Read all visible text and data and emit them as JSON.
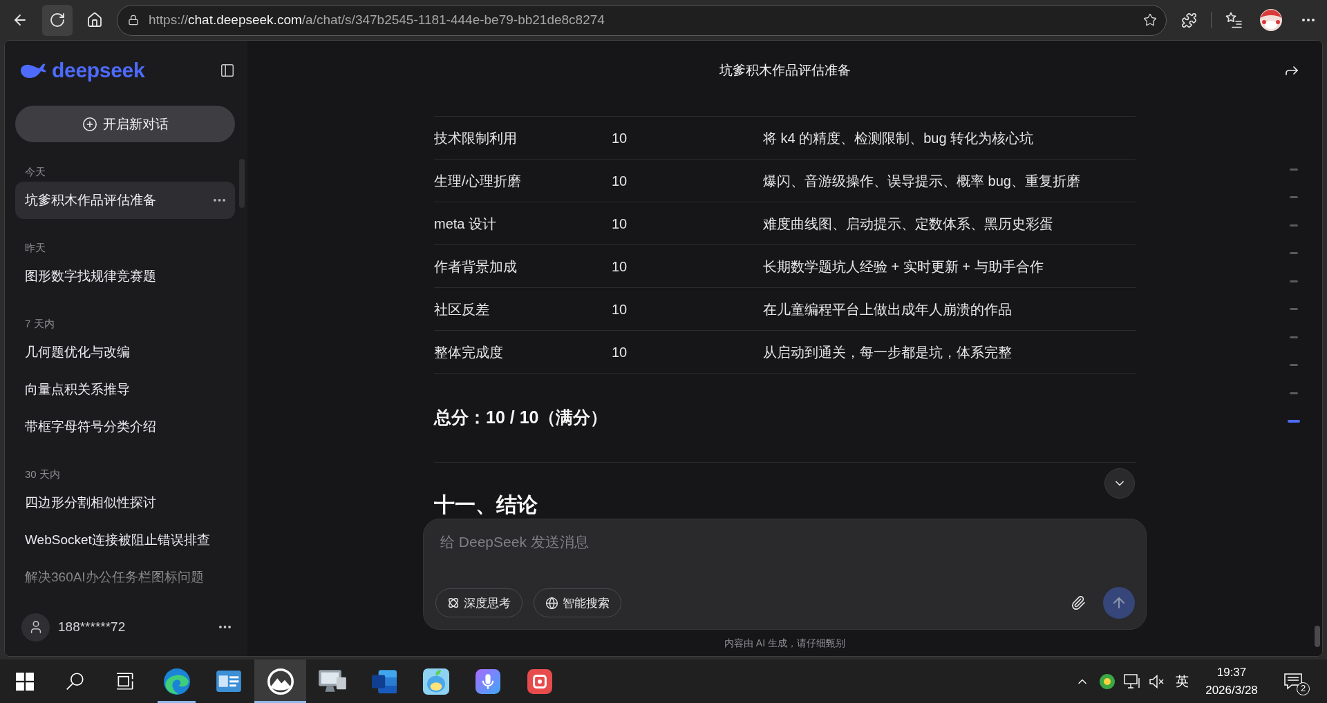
{
  "browser": {
    "nav_buttons": [
      {
        "kind": "back",
        "highlighted": false
      },
      {
        "kind": "refresh",
        "highlighted": true
      },
      {
        "kind": "home",
        "highlighted": false
      }
    ],
    "address": {
      "scheme": "https://",
      "host": "chat.deepseek.com",
      "path": "/a/chat/s/347b2545-1181-444e-be79-bb21de8c8274"
    },
    "toolbar": [
      {
        "kind": "extensions"
      },
      {
        "kind": "favorites"
      },
      {
        "kind": "profile"
      },
      {
        "kind": "more"
      }
    ]
  },
  "sidebar": {
    "logo": "deepseek",
    "new_chat": "开启新对话",
    "groups": [
      {
        "label": "今天",
        "items": [
          {
            "title": "坑爹积木作品评估准备",
            "selected": true
          }
        ]
      },
      {
        "label": "昨天",
        "items": [
          {
            "title": "图形数字找规律竞赛题",
            "selected": false
          }
        ]
      },
      {
        "label": "7 天内",
        "items": [
          {
            "title": "几何题优化与改编",
            "selected": false
          },
          {
            "title": "向量点积关系推导",
            "selected": false
          },
          {
            "title": "带框字母符号分类介绍",
            "selected": false
          }
        ]
      },
      {
        "label": "30 天内",
        "items": [
          {
            "title": "四边形分割相似性探讨",
            "selected": false
          },
          {
            "title": "WebSocket连接被阻止错误排查",
            "selected": false
          },
          {
            "title": "解决360AI办公任务栏图标问题",
            "selected": false
          }
        ]
      }
    ],
    "user": "188******72"
  },
  "chat": {
    "title": "坑爹积木作品评估准备",
    "table": {
      "rows": [
        [
          "技术限制利用",
          "10",
          "将 k4 的精度、检测限制、bug 转化为核心坑"
        ],
        [
          "生理/心理折磨",
          "10",
          "爆闪、音游级操作、误导提示、概率 bug、重复折磨"
        ],
        [
          "meta 设计",
          "10",
          "难度曲线图、启动提示、定数体系、黑历史彩蛋"
        ],
        [
          "作者背景加成",
          "10",
          "长期数学题坑人经验 + 实时更新 + 与助手合作"
        ],
        [
          "社区反差",
          "10",
          "在儿童编程平台上做出成年人崩溃的作品"
        ],
        [
          "整体完成度",
          "10",
          "从启动到通关，每一步都是坑，体系完整"
        ]
      ]
    },
    "summary": "总分：10 / 10（满分）",
    "section_heading": "十一、结论"
  },
  "message_markers": [
    {
      "selected": false
    },
    {
      "selected": false
    },
    {
      "selected": false
    },
    {
      "selected": false
    },
    {
      "selected": false
    },
    {
      "selected": false
    },
    {
      "selected": false
    },
    {
      "selected": false
    },
    {
      "selected": false
    },
    {
      "selected": true
    }
  ],
  "composer": {
    "placeholder": "给 DeepSeek 发送消息",
    "toggles": [
      {
        "kind": "deep_think",
        "label": "深度思考",
        "on": false
      },
      {
        "kind": "web_search",
        "label": "智能搜索",
        "on": false
      }
    ],
    "send_button": {
      "disabled": true
    },
    "disclaimer": "内容由 AI 生成，请仔细甄别"
  },
  "taskbar": {
    "buttons": [
      {
        "kind": "start"
      },
      {
        "kind": "search"
      },
      {
        "kind": "task_view"
      }
    ],
    "apps": [
      {
        "kind": "edge",
        "running": true,
        "selected": false
      },
      {
        "kind": "card",
        "running": false,
        "selected": false
      },
      {
        "kind": "mountain",
        "running": true,
        "selected": true
      },
      {
        "kind": "monitor",
        "running": false,
        "selected": false
      },
      {
        "kind": "word",
        "running": false,
        "selected": false
      },
      {
        "kind": "cartoon",
        "running": false,
        "selected": false
      },
      {
        "kind": "microphone",
        "running": false,
        "selected": false
      },
      {
        "kind": "tile",
        "running": false,
        "selected": false
      }
    ],
    "tray_icons": [
      {
        "kind": "chevron"
      },
      {
        "kind": "app_status"
      },
      {
        "kind": "network"
      }
    ],
    "volume": {
      "muted": true
    },
    "ime": "英",
    "time": "19:37",
    "date": "2026/3/28",
    "notification_count": "2"
  }
}
